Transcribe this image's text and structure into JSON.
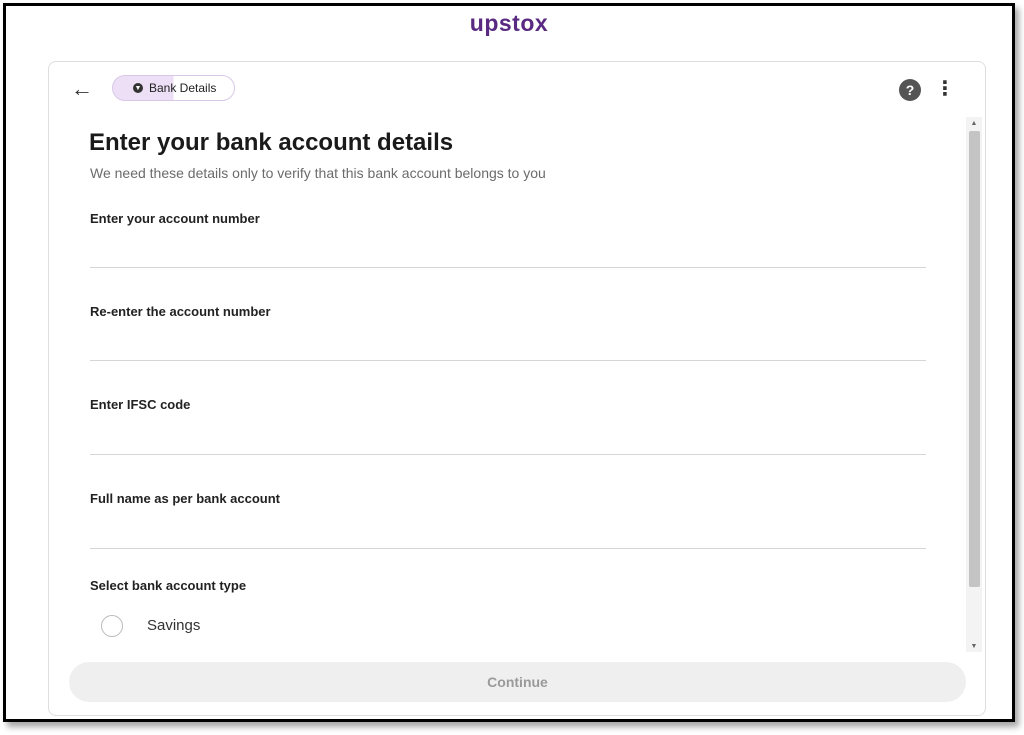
{
  "header": {
    "brand": "upstox",
    "chip_label": "Bank Details"
  },
  "form": {
    "title": "Enter your bank account details",
    "subtitle": "We need these details only to verify that this bank account belongs to you",
    "fields": [
      {
        "label": "Enter your account number",
        "value": ""
      },
      {
        "label": "Re-enter the account number",
        "value": ""
      },
      {
        "label": "Enter IFSC code",
        "value": ""
      },
      {
        "label": "Full name as per bank account",
        "value": ""
      }
    ],
    "account_type_label": "Select bank account type",
    "account_type_options": [
      "Savings"
    ]
  },
  "actions": {
    "continue_label": "Continue"
  },
  "icons": {
    "back": "back-arrow-icon",
    "chip": "chevron-down-circle-icon",
    "help": "help-icon",
    "more": "more-vertical-icon"
  },
  "colors": {
    "brand": "#5a2a82",
    "chip_fill": "#ecdff6",
    "button_disabled": "#efefef"
  }
}
